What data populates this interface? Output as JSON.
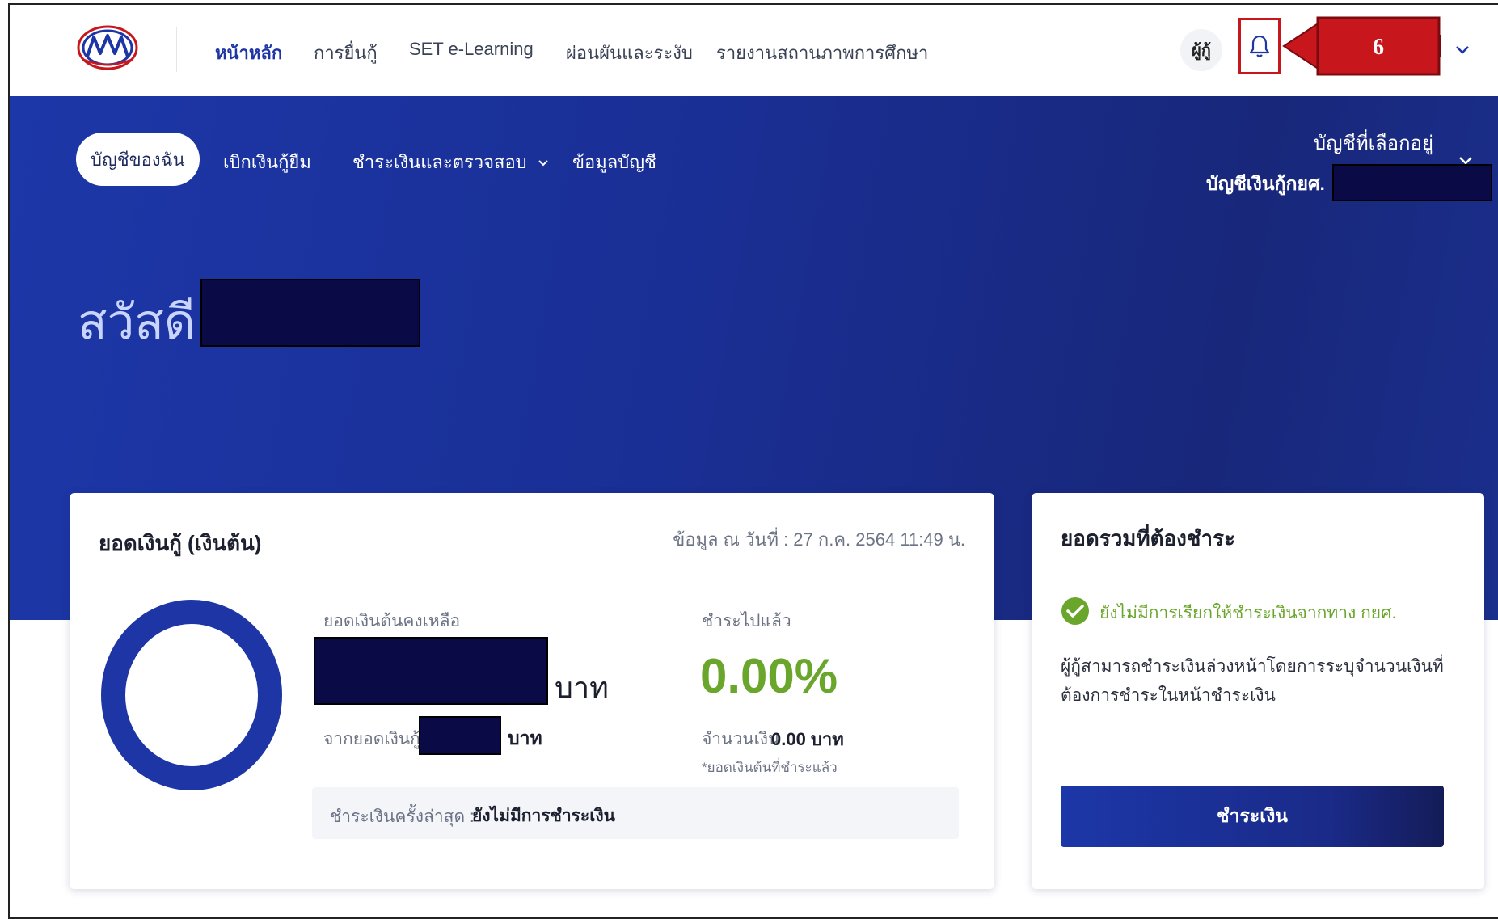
{
  "nav": {
    "items": [
      "หน้าหลัก",
      "การยื่นกู้",
      "SET e-Learning",
      "ผ่อนผันและระงับ",
      "รายงานสถานภาพการศึกษา"
    ],
    "user_label": "ผู้กู้",
    "callout_number": "6",
    "icons": {
      "logo": "kyf-logo",
      "bell": "bell-icon",
      "chevron": "chevron-down-icon"
    },
    "accent": "#1e35a6",
    "callout_color": "#c8161d"
  },
  "hero": {
    "tabs": [
      "บัญชีของฉัน",
      "เบิกเงินกู้ยืม",
      "ชำระเงินและตรวจสอบ",
      "ข้อมูลบัญชี"
    ],
    "account_label": "บัญชีที่เลือกอยู่",
    "account_value": "บัญชีเงินกู้กยศ.",
    "greeting": "สวัสดี"
  },
  "loan_card": {
    "title": "ยอดเงินกู้ (เงินต้น)",
    "as_of": "ข้อมูล ณ วันที่ : 27 ก.ค. 2564 11:49 น.",
    "remaining_label": "ยอดเงินต้นคงเหลือ",
    "currency": "บาท",
    "from_label": "จากยอดเงินกู้",
    "paid_label": "ชำระไปแล้ว",
    "paid_percent": "0.00%",
    "amount_label": "จำนวนเงิน",
    "amount_value": "0.00 บาท",
    "note": "*ยอดเงินต้นที่ชำระแล้ว",
    "last_payment_label": "ชำระเงินครั้งล่าสุด :",
    "last_payment_value": "ยังไม่มีการชำระเงิน",
    "paid_fraction": 0.0
  },
  "due_card": {
    "title": "ยอดรวมที่ต้องชำระ",
    "status": "ยังไม่มีการเรียกให้ชำระเงินจากทาง กยศ.",
    "description_line1": "ผู้กู้สามารถชำระเงินล่วงหน้าโดยการระบุจำนวนเงินที่",
    "description_line2": "ต้องการชำระในหน้าชำระเงิน",
    "pay_button": "ชำระเงิน",
    "status_color": "#6aa62c"
  }
}
